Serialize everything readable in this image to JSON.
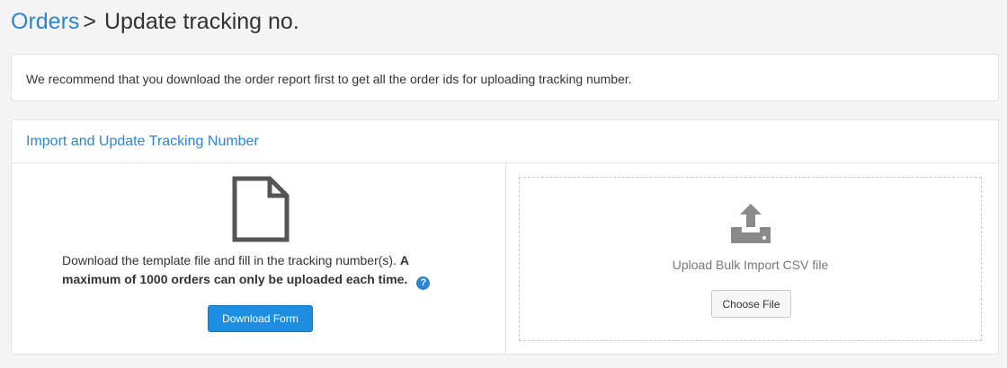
{
  "header": {
    "breadcrumb_root": "Orders",
    "separator": ">",
    "title": "Update tracking no."
  },
  "notice": {
    "text": "We recommend that you download the order report first to get all the order ids for uploading tracking number."
  },
  "panel": {
    "title": "Import and Update Tracking Number",
    "left": {
      "icon": "file-icon",
      "description": "Download the template file and fill in the tracking number(s).",
      "description_bold": "A maximum of 1000 orders can only be uploaded each time.",
      "help_icon": "?",
      "download_button": "Download Form"
    },
    "right": {
      "icon": "upload-icon",
      "upload_text": "Upload Bulk Import CSV file",
      "choose_button": "Choose File"
    }
  },
  "colors": {
    "accent": "#2a86d1",
    "button_primary": "#1c8de0",
    "icon_grey": "#555555",
    "upload_icon_grey": "#8a8a8a"
  }
}
